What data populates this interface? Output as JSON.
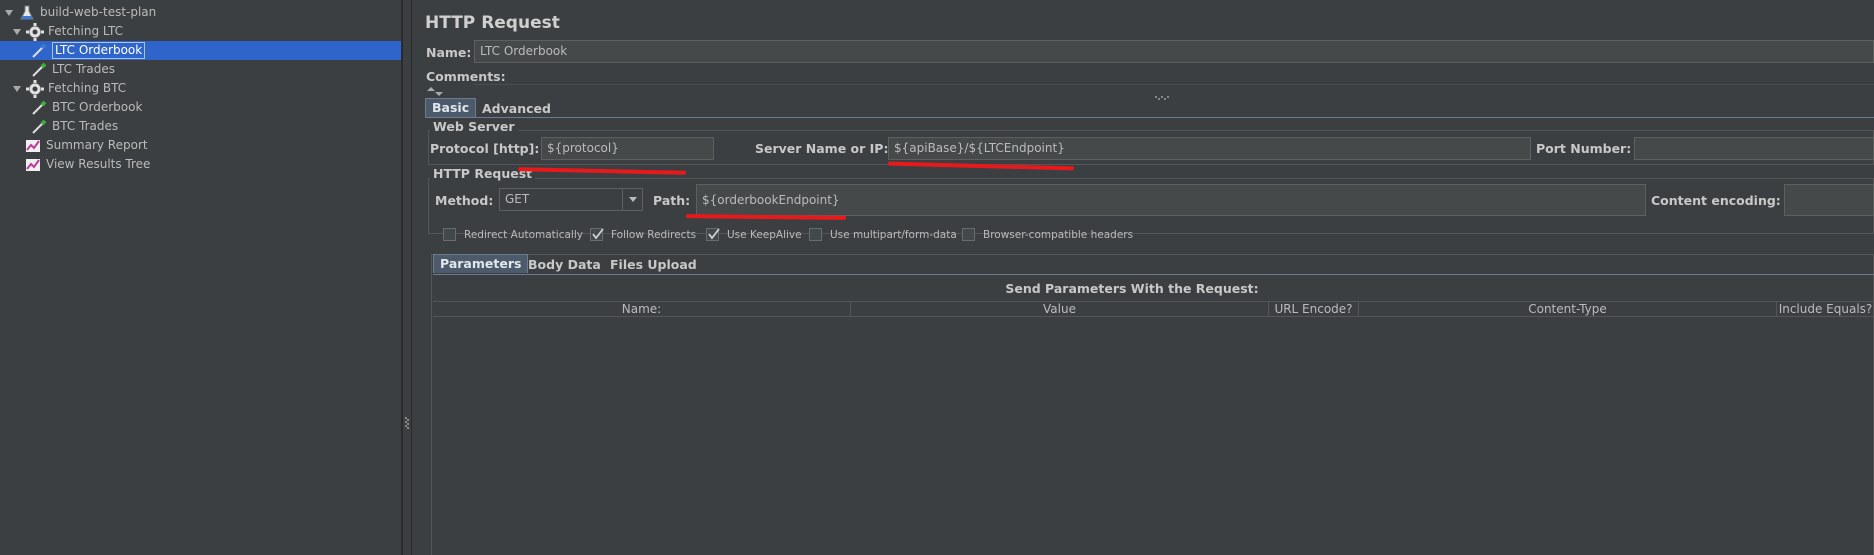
{
  "tree": {
    "items": [
      {
        "label": "build-web-test-plan"
      },
      {
        "label": "Fetching LTC"
      },
      {
        "label": "LTC Orderbook"
      },
      {
        "label": "LTC Trades"
      },
      {
        "label": "Fetching BTC"
      },
      {
        "label": "BTC Orderbook"
      },
      {
        "label": "BTC Trades"
      },
      {
        "label": "Summary Report"
      },
      {
        "label": "View Results Tree"
      }
    ]
  },
  "panel": {
    "title": "HTTP Request",
    "name_label": "Name:",
    "name_value": "LTC Orderbook",
    "comments_label": "Comments:",
    "tabs": [
      {
        "label": "Basic",
        "active": true
      },
      {
        "label": "Advanced",
        "active": false
      }
    ],
    "web_server": {
      "title": "Web Server",
      "protocol_label": "Protocol [http]:",
      "protocol_value": "${protocol}",
      "server_label": "Server Name or IP:",
      "server_value": "${apiBase}/${LTCEndpoint}",
      "port_label": "Port Number:",
      "port_value": ""
    },
    "http_request": {
      "title": "HTTP Request",
      "method_label": "Method:",
      "method_value": "GET",
      "path_label": "Path:",
      "path_value": "${orderbookEndpoint}",
      "encoding_label": "Content encoding:",
      "encoding_value": ""
    },
    "checkboxes": [
      {
        "label": "Redirect Automatically",
        "checked": false
      },
      {
        "label": "Follow Redirects",
        "checked": true
      },
      {
        "label": "Use KeepAlive",
        "checked": true
      },
      {
        "label": "Use multipart/form-data",
        "checked": false
      },
      {
        "label": "Browser-compatible headers",
        "checked": false
      }
    ],
    "sub_tabs": [
      {
        "label": "Parameters",
        "active": true
      },
      {
        "label": "Body Data",
        "active": false
      },
      {
        "label": "Files Upload",
        "active": false
      }
    ],
    "params": {
      "title": "Send Parameters With the Request:",
      "columns": [
        "Name:",
        "Value",
        "URL Encode?",
        "Content-Type",
        "Include Equals?"
      ]
    }
  },
  "colors": {
    "background": "#3c3f41",
    "selection": "#2f65ca",
    "annotation_red": "#e8191a"
  }
}
